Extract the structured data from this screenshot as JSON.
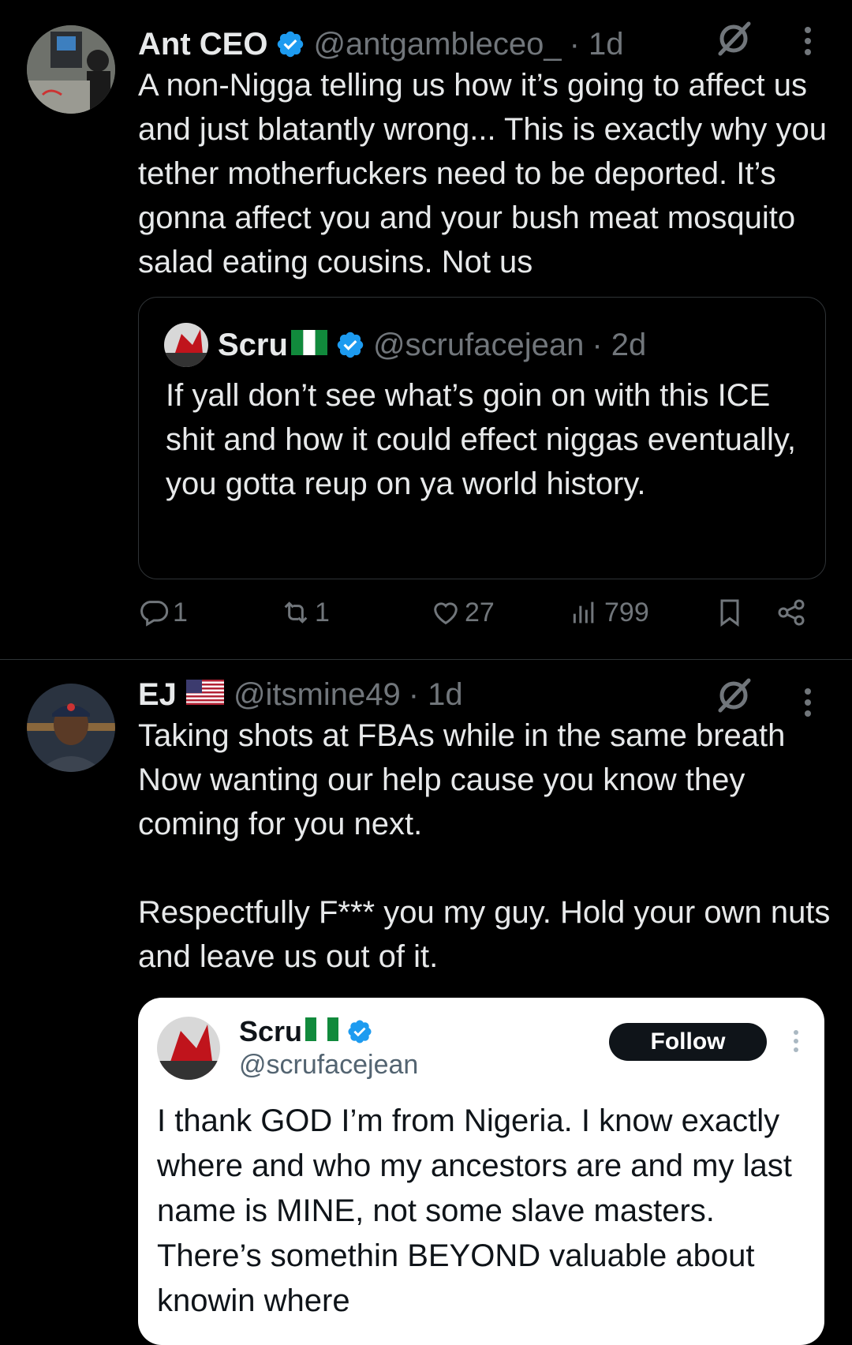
{
  "posts": [
    {
      "name": "Ant CEO",
      "handle": "@antgambleceo_",
      "time": "· 1d",
      "text": "A non-Nigga telling us how it’s going to affect us and just blatantly wrong... This is exactly why you tether motherfuckers need to be deported. It’s gonna affect you and your bush meat mosquito salad eating cousins. Not us",
      "quote": {
        "name": "Scru",
        "handle": "@scrufacejean",
        "time": "· 2d",
        "text": "If yall don’t see what’s goin on with this ICE shit and how it could effect niggas eventually, you gotta reup on ya world history."
      },
      "actions": {
        "replies": "1",
        "reposts": "1",
        "likes": "27",
        "views": "799"
      }
    },
    {
      "name": "EJ",
      "handle": "@itsmine49",
      "time": "· 1d",
      "text": "Taking shots at FBAs while in the same breath Now wanting our help cause you know they coming for you next.\n\nRespectfully F*** you my guy. Hold your own nuts and leave us out of it.",
      "screenshot": {
        "name": "Scru",
        "handle": "@scrufacejean",
        "follow_label": "Follow",
        "text": "I thank GOD I’m from Nigeria. I know exactly where and who my ancestors are and my last name is MINE, not some slave masters. There’s somethin BEYOND valuable about knowin where"
      }
    }
  ],
  "colors": {
    "background": "#000000",
    "text": "#e7e9ea",
    "muted": "#71767b",
    "verified": "#1d9bf0",
    "border": "#2f3336"
  },
  "icons": [
    "verified-badge-icon",
    "grok-icon",
    "more-icon",
    "reply-icon",
    "repost-icon",
    "like-icon",
    "views-icon",
    "bookmark-icon",
    "share-icon",
    "nigeria-flag-icon",
    "us-flag-icon"
  ]
}
